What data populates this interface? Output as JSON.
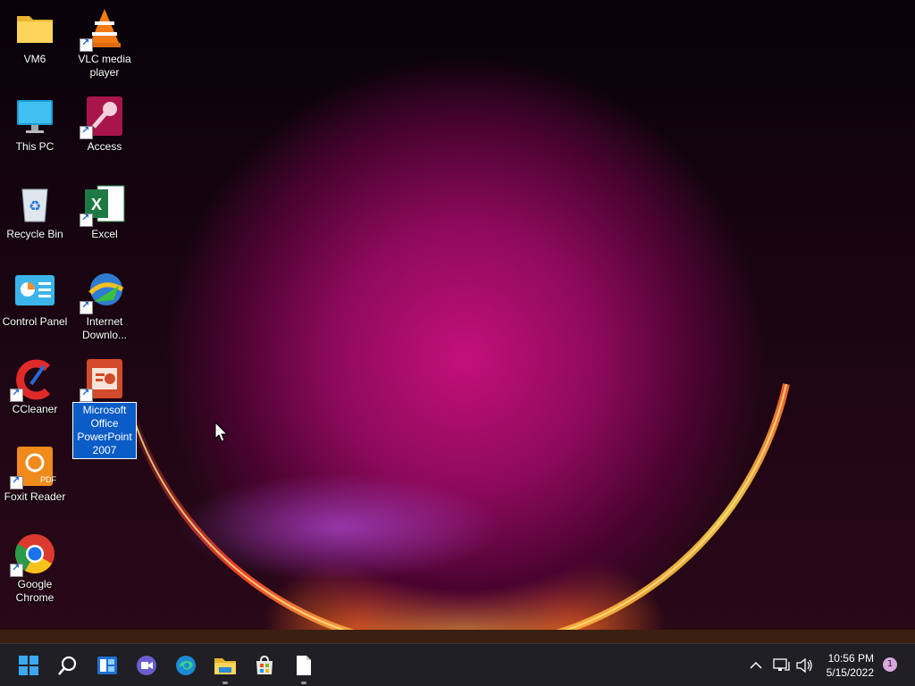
{
  "desktop": {
    "icons": [
      {
        "label": "VM6",
        "icon": "folder-icon"
      },
      {
        "label": "VLC media player",
        "icon": "vlc-icon"
      },
      {
        "label": "This PC",
        "icon": "monitor-icon"
      },
      {
        "label": "Access",
        "icon": "access-icon"
      },
      {
        "label": "Recycle Bin",
        "icon": "recycle-bin-icon"
      },
      {
        "label": "Excel",
        "icon": "excel-icon"
      },
      {
        "label": "Control Panel",
        "icon": "control-panel-icon"
      },
      {
        "label": "Internet Downlo...",
        "icon": "internet-download-manager-icon"
      },
      {
        "label": "CCleaner",
        "icon": "ccleaner-icon"
      },
      {
        "label": "Microsoft Office PowerPoint 2007",
        "icon": "powerpoint-icon",
        "selected": true
      },
      {
        "label": "Foxit Reader",
        "icon": "foxit-reader-icon"
      },
      {
        "label": "Google Chrome",
        "icon": "chrome-icon"
      }
    ]
  },
  "taskbar": {
    "apps": [
      "start-icon",
      "search-icon",
      "widgets-icon",
      "teams-chat-icon",
      "edge-icon",
      "file-explorer-icon",
      "store-icon",
      "notepad-icon"
    ],
    "clock": {
      "time": "10:56 PM",
      "date": "5/15/2022"
    },
    "notification_count": "1"
  },
  "colors": {
    "taskbar": "#1f1f24",
    "selection": "#0b5cc6",
    "accent": "#c4107a"
  }
}
